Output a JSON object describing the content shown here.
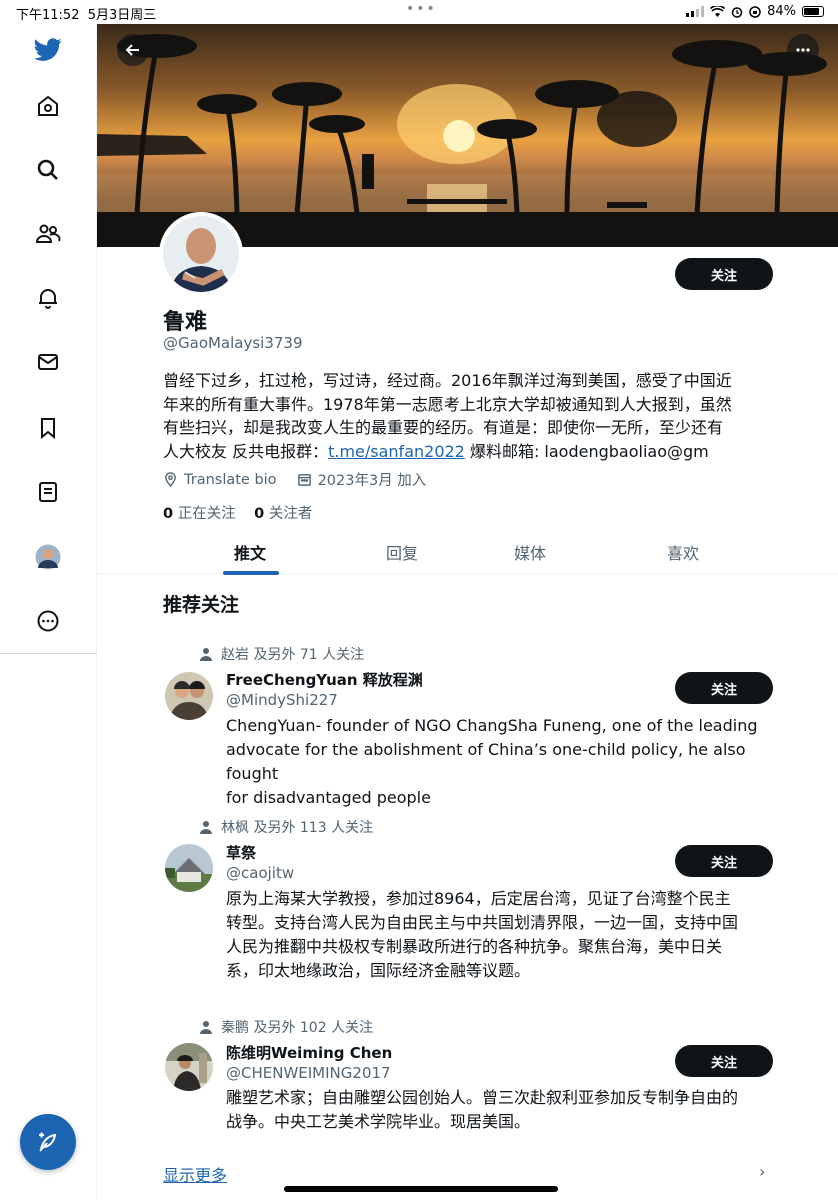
{
  "status_bar": {
    "time": "下午11:52",
    "date": "5月3日周三",
    "battery": "84%",
    "battery_level": 0.84
  },
  "sidebar": {
    "items": [
      {
        "icon": "twitter-logo-icon"
      },
      {
        "icon": "home-icon"
      },
      {
        "icon": "search-icon"
      },
      {
        "icon": "communities-icon"
      },
      {
        "icon": "notifications-bell-icon"
      },
      {
        "icon": "messages-envelope-icon"
      },
      {
        "icon": "bookmark-icon"
      },
      {
        "icon": "lists-icon"
      },
      {
        "icon": "profile-avatar"
      },
      {
        "icon": "more-circle-icon"
      }
    ],
    "compose_icon": "compose-feather-icon",
    "accent_color": "#1d64b2"
  },
  "profile": {
    "name": "鲁难",
    "handle": "@GaoMalaysi3739",
    "follow_label": "关注",
    "bio_lines": [
      "曾经下过乡，扛过枪，写过诗，经过商。2016年飘洋过海到美国，感受了中国近",
      "年来的所有重大事件。1978年第一志愿考上北京大学却被通知到人大报到，虽然",
      "有些扫兴，却是我改变人生的最重要的经历。有道是：即使你一无所，至少还有"
    ],
    "bio_last_prefix": "人大校友 反共电报群：",
    "bio_link": "t.me/sanfan2022",
    "bio_last_suffix": " 爆料邮箱: laodengbaoliao@gm",
    "translate_bio": "Translate bio",
    "joined": "2023年3月 加入",
    "following_count": "0",
    "following_label": "正在关注",
    "followers_count": "0",
    "followers_label": "关注者"
  },
  "tabs": [
    {
      "label": "推文",
      "active": true
    },
    {
      "label": "回复",
      "active": false
    },
    {
      "label": "媒体",
      "active": false
    },
    {
      "label": "喜欢",
      "active": false
    }
  ],
  "suggestions": {
    "title": "推荐关注",
    "items": [
      {
        "social": "赵岩 及另外 71 人关注",
        "name": "FreeChengYuan 释放程渊",
        "handle": "@MindyShi227",
        "bio_lines": [
          "ChengYuan- founder of NGO ChangSha Funeng, one of the leading",
          "advocate for the abolishment of China’s one-child policy, he also fought",
          "for disadvantaged people"
        ],
        "follow_label": "关注"
      },
      {
        "social": "林枫 及另外 113 人关注",
        "name": "草祭",
        "handle": "@caojitw",
        "bio_lines": [
          "原为上海某大学教授，参加过8964，后定居台湾，见证了台湾整个民主",
          "转型。支持台湾人民为自由民主与中共国划清界限，一边一国，支持中国",
          "人民为推翻中共极权专制暴政所进行的各种抗争。聚焦台海，美中日关",
          "系，印太地缘政治，国际经济金融等议题。"
        ],
        "follow_label": "关注"
      },
      {
        "social": "秦鹏 及另外 102 人关注",
        "name": "陈维明Weiming Chen",
        "handle": "@CHENWEIMING2017",
        "bio_lines": [
          "雕塑艺术家；自由雕塑公园创始人。曾三次赴叙利亚参加反专制争自由的",
          "战争。中央工艺美术学院毕业。现居美国。"
        ],
        "follow_label": "关注"
      }
    ],
    "show_more": "显示更多"
  }
}
